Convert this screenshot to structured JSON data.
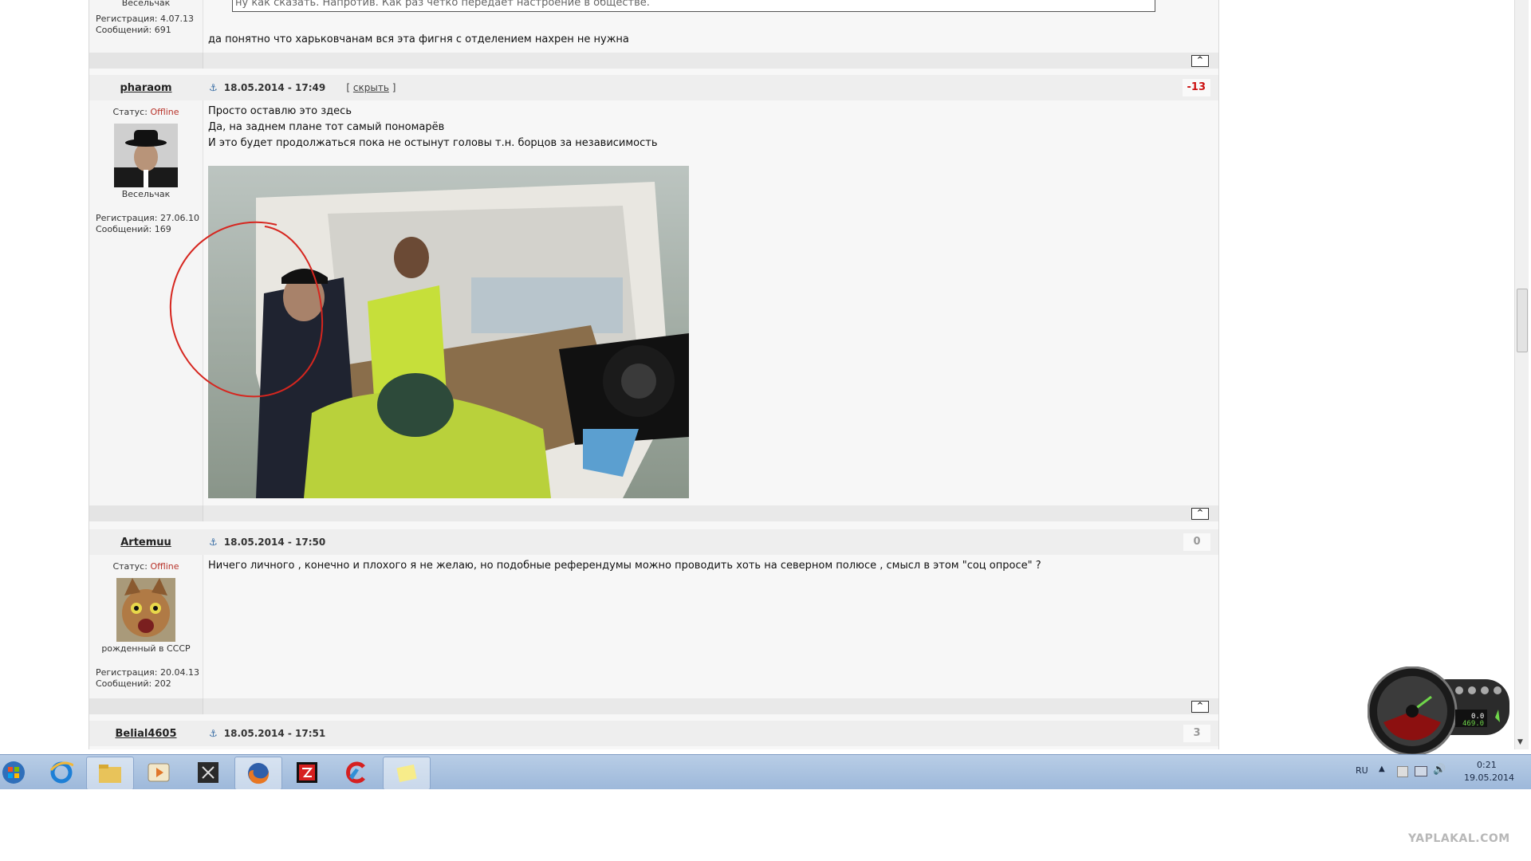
{
  "quote": {
    "text": "ну как сказать. Напротив. Как раз четко передает настроение в обществе."
  },
  "posts": [
    {
      "id": "prev",
      "rank": "Весельчак",
      "registration": "Регистрация: 4.07.13",
      "messages": "Сообщений: 691",
      "body": [
        "да понятно что харьковчанам вся эта фигня с отделением нахрен не нужна"
      ]
    },
    {
      "id": "pharaom",
      "author": "pharaom",
      "date": "18.05.2014 - 17:49",
      "hide_link": "скрыть",
      "rating": "-13",
      "status_label": "Статус:",
      "status_value": "Offline",
      "rank": "Весельчак",
      "registration": "Регистрация: 27.06.10",
      "messages": "Сообщений: 169",
      "body": [
        "Просто оставлю это здесь",
        "Да, на заднем плане тот самый пономарёв",
        "И это будет продолжаться пока не остынут головы т.н. борцов за независимость"
      ]
    },
    {
      "id": "artemuu",
      "author": "Artemuu",
      "date": "18.05.2014 - 17:50",
      "rating": "0",
      "status_label": "Статус:",
      "status_value": "Offline",
      "rank": "рожденный в СССР",
      "registration": "Регистрация: 20.04.13",
      "messages": "Сообщений: 202",
      "body": [
        "Ничего личного , конечно и плохого я не желаю, но подобные референдумы можно проводить хоть на северном полюсе , смысл в этом \"соц опросе\" ?"
      ]
    },
    {
      "id": "belial",
      "author": "Belial4605",
      "date": "18.05.2014 - 17:51",
      "rating": "3"
    }
  ],
  "up_label": "^",
  "gauge": {
    "value_top": "0.0",
    "value_bottom": "469.0"
  },
  "taskbar": {
    "lang": "RU",
    "time": "0:21",
    "date": "19.05.2014"
  },
  "watermark": "YAPLAKAL.COM"
}
